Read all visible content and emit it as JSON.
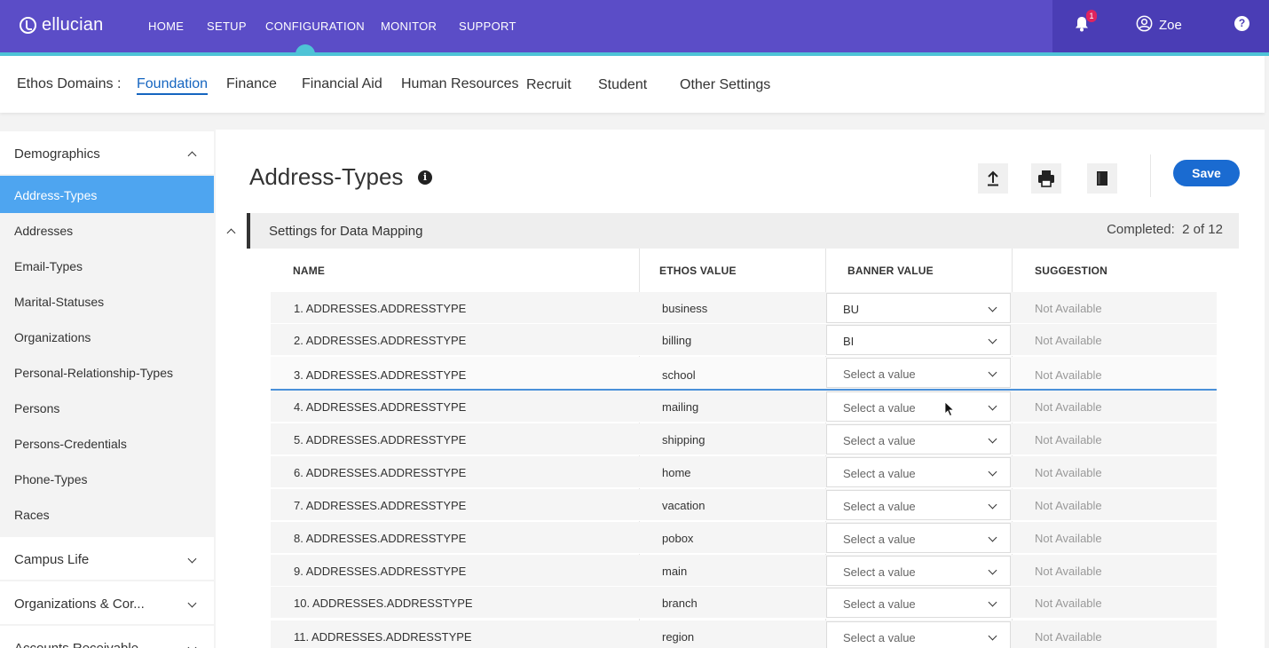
{
  "brand": {
    "name": "ellucian"
  },
  "topnav": [
    "HOME",
    "SETUP",
    "CONFIGURATION",
    "MONITOR",
    "SUPPORT"
  ],
  "notifications": {
    "count": "1"
  },
  "user": {
    "name": "Zoe"
  },
  "domains": {
    "label": "Ethos Domains :",
    "items": [
      "Foundation",
      "Finance",
      "Financial Aid",
      "Human Resources",
      "Recruit",
      "Student",
      "Other Settings"
    ],
    "active": "Foundation"
  },
  "sidebar": {
    "groups": [
      {
        "label": "Demographics",
        "expanded": true
      },
      {
        "label": "Campus Life",
        "expanded": false
      },
      {
        "label": "Organizations & Cor...",
        "expanded": false
      },
      {
        "label": "Accounts Receivable",
        "expanded": false
      }
    ],
    "items": [
      "Address-Types",
      "Addresses",
      "Email-Types",
      "Marital-Statuses",
      "Organizations",
      "Personal-Relationship-Types",
      "Persons",
      "Persons-Credentials",
      "Phone-Types",
      "Races"
    ],
    "active": "Address-Types"
  },
  "page": {
    "title": "Address-Types",
    "save_label": "Save",
    "section_title": "Settings for Data Mapping",
    "completed_label": "Completed:",
    "completed_value": "2 of 12"
  },
  "table": {
    "headers": [
      "NAME",
      "ETHOS VALUE",
      "BANNER VALUE",
      "SUGGESTION"
    ],
    "rows": [
      {
        "name": "1.  ADDRESSES.ADDRESSTYPE",
        "ethos": "business",
        "banner": "BU",
        "suggestion": "Not Available"
      },
      {
        "name": "2.  ADDRESSES.ADDRESSTYPE",
        "ethos": "billing",
        "banner": "BI",
        "suggestion": "Not Available"
      },
      {
        "name": "3.  ADDRESSES.ADDRESSTYPE",
        "ethos": "school",
        "banner": "Select a value",
        "suggestion": "Not Available"
      },
      {
        "name": "4.  ADDRESSES.ADDRESSTYPE",
        "ethos": "mailing",
        "banner": "Select a value",
        "suggestion": "Not Available"
      },
      {
        "name": "5.  ADDRESSES.ADDRESSTYPE",
        "ethos": "shipping",
        "banner": "Select a value",
        "suggestion": "Not Available"
      },
      {
        "name": "6.  ADDRESSES.ADDRESSTYPE",
        "ethos": "home",
        "banner": "Select a value",
        "suggestion": "Not Available"
      },
      {
        "name": "7.  ADDRESSES.ADDRESSTYPE",
        "ethos": "vacation",
        "banner": "Select a value",
        "suggestion": "Not Available"
      },
      {
        "name": "8.  ADDRESSES.ADDRESSTYPE",
        "ethos": "pobox",
        "banner": "Select a value",
        "suggestion": "Not Available"
      },
      {
        "name": "9.  ADDRESSES.ADDRESSTYPE",
        "ethos": "main",
        "banner": "Select a value",
        "suggestion": "Not Available"
      },
      {
        "name": "10. ADDRESSES.ADDRESSTYPE",
        "ethos": "branch",
        "banner": "Select a value",
        "suggestion": "Not Available"
      },
      {
        "name": "11. ADDRESSES.ADDRESSTYPE",
        "ethos": "region",
        "banner": "Select a value",
        "suggestion": "Not Available"
      }
    ]
  },
  "icons": {
    "upload": "upload-icon",
    "print": "print-icon",
    "document": "document-icon",
    "info": "info-icon",
    "bell": "bell-icon",
    "user": "user-icon",
    "help": "help-icon"
  },
  "colors": {
    "topbar": "#5b4dc7",
    "accent": "#4ec3d6",
    "active_item": "#4ea5f0",
    "save": "#1a6bd1"
  }
}
